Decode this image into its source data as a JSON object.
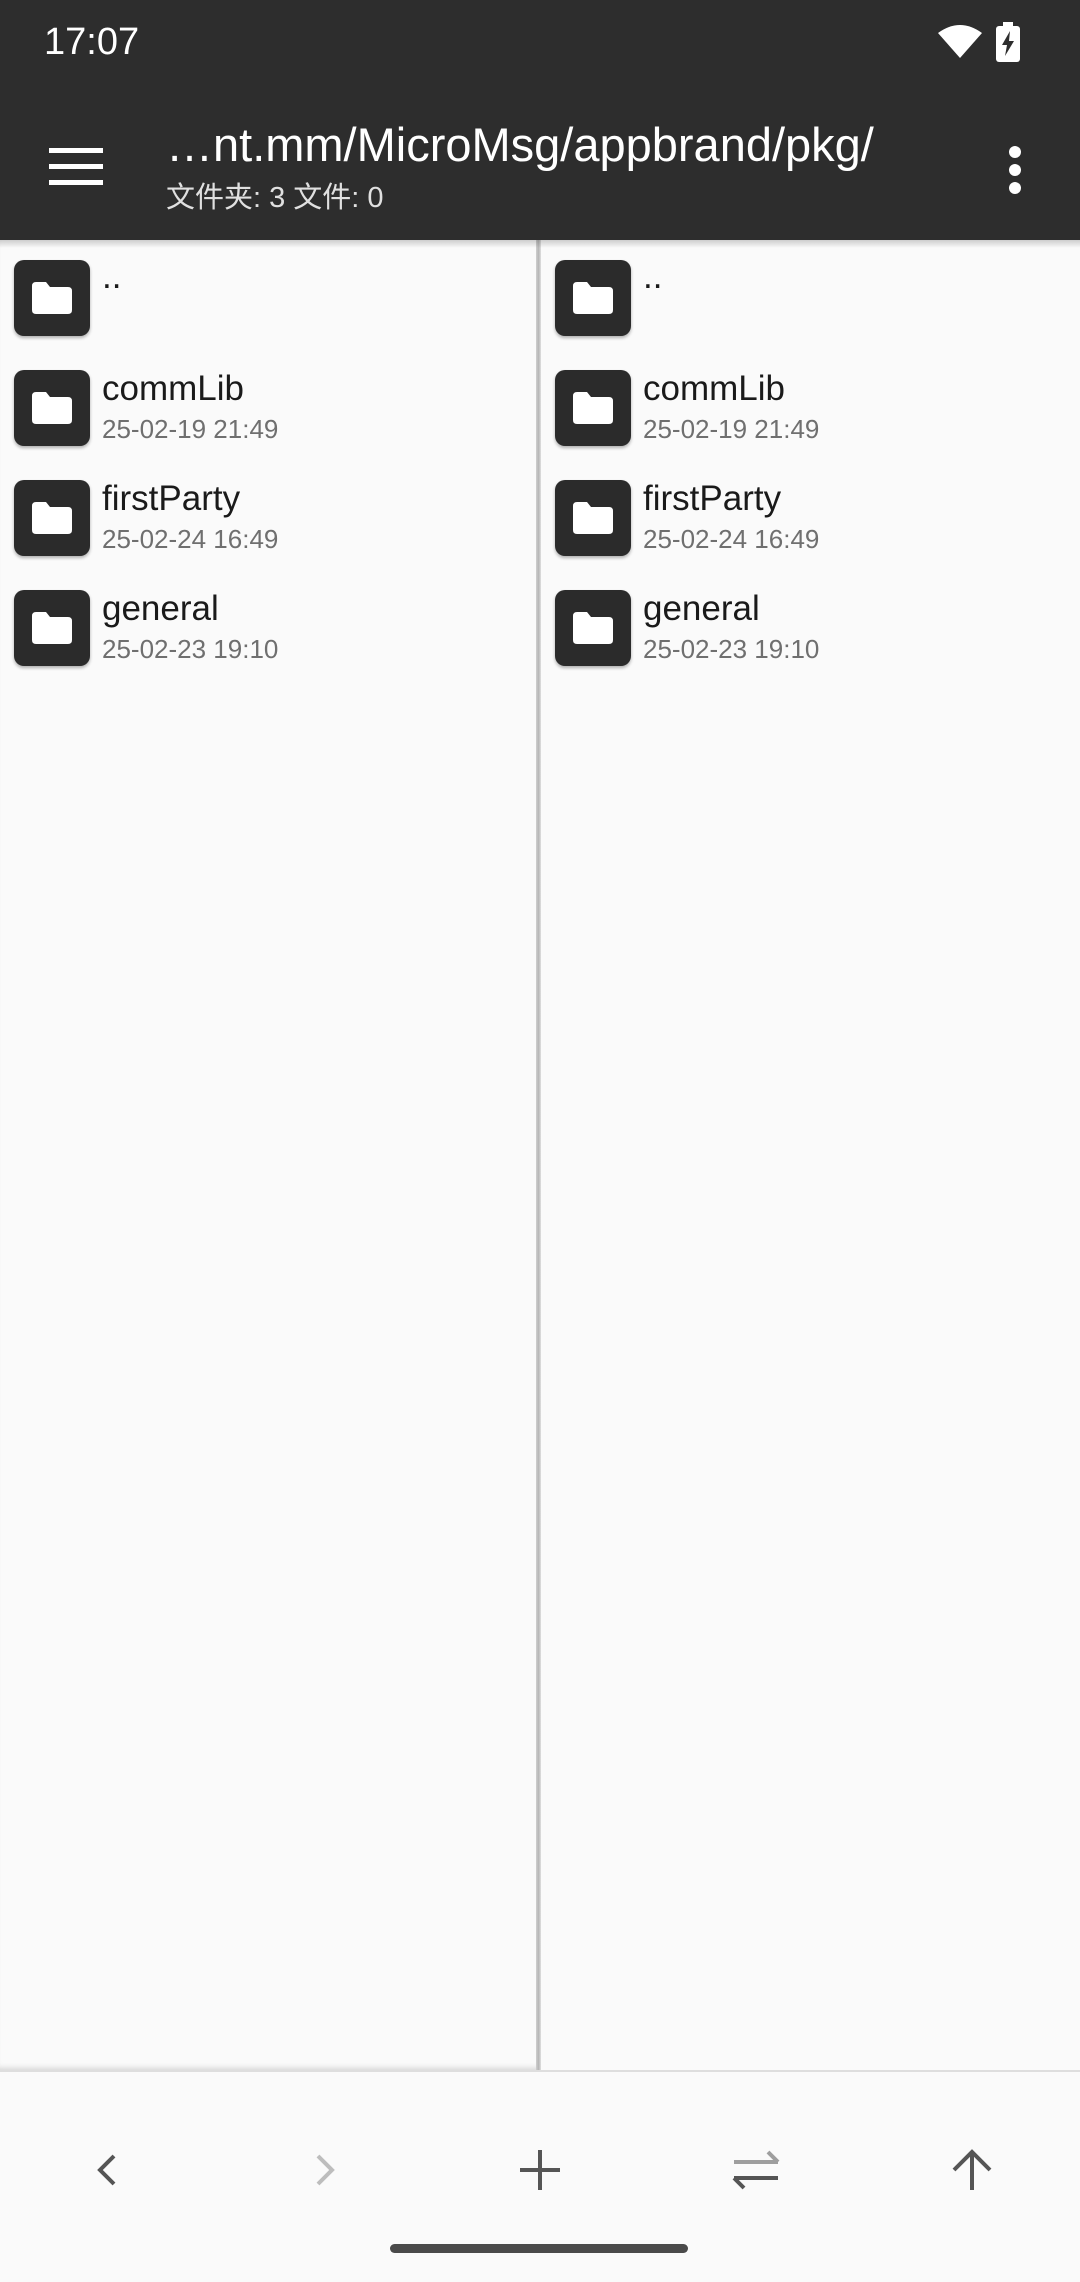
{
  "status_bar": {
    "time": "17:07",
    "icons": [
      "wifi-icon",
      "battery-charging-icon"
    ]
  },
  "app_bar": {
    "menu_icon": "hamburger-menu-icon",
    "path": "…nt.mm/MicroMsg/appbrand/pkg/",
    "summary": "文件夹: 3  文件: 0",
    "more_icon": "more-vertical-icon"
  },
  "panes": {
    "left": {
      "items": [
        {
          "name": "..",
          "date": ""
        },
        {
          "name": "commLib",
          "date": "25-02-19 21:49"
        },
        {
          "name": "firstParty",
          "date": "25-02-24 16:49"
        },
        {
          "name": "general",
          "date": "25-02-23 19:10"
        }
      ]
    },
    "right": {
      "items": [
        {
          "name": "..",
          "date": ""
        },
        {
          "name": "commLib",
          "date": "25-02-19 21:49"
        },
        {
          "name": "firstParty",
          "date": "25-02-24 16:49"
        },
        {
          "name": "general",
          "date": "25-02-23 19:10"
        }
      ]
    }
  },
  "bottom_bar": {
    "buttons": [
      "back-icon",
      "forward-icon",
      "add-icon",
      "swap-panes-icon",
      "up-directory-icon"
    ],
    "forward_enabled": false
  },
  "colors": {
    "app_bar": "#2d2d2d",
    "background": "#fafafa",
    "folder_tile": "#2b2b2b"
  }
}
